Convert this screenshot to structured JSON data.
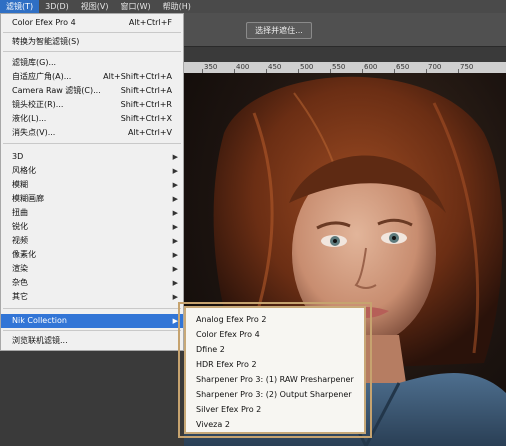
{
  "menubar": {
    "items": [
      "滤镜(T)",
      "3D(D)",
      "视图(V)",
      "窗口(W)",
      "帮助(H)"
    ]
  },
  "optbar": {
    "button_label": "选择并遮住..."
  },
  "ruler": {
    "ticks": [
      "350",
      "400",
      "450",
      "500",
      "550",
      "600",
      "650",
      "700",
      "750"
    ]
  },
  "filter_menu": {
    "items": [
      {
        "label": "Color Efex Pro 4",
        "shortcut": "Alt+Ctrl+F"
      },
      {
        "label": "转换为智能滤镜(S)",
        "shortcut": ""
      },
      {
        "label": "滤镜库(G)...",
        "shortcut": ""
      },
      {
        "label": "自适应广角(A)...",
        "shortcut": "Alt+Shift+Ctrl+A"
      },
      {
        "label": "Camera Raw 滤镜(C)...",
        "shortcut": "Shift+Ctrl+A"
      },
      {
        "label": "镜头校正(R)...",
        "shortcut": "Shift+Ctrl+R"
      },
      {
        "label": "液化(L)...",
        "shortcut": "Shift+Ctrl+X"
      },
      {
        "label": "消失点(V)...",
        "shortcut": "Alt+Ctrl+V"
      },
      {
        "label": "3D",
        "shortcut": ""
      },
      {
        "label": "风格化",
        "shortcut": ""
      },
      {
        "label": "模糊",
        "shortcut": ""
      },
      {
        "label": "模糊画廊",
        "shortcut": ""
      },
      {
        "label": "扭曲",
        "shortcut": ""
      },
      {
        "label": "锐化",
        "shortcut": ""
      },
      {
        "label": "视频",
        "shortcut": ""
      },
      {
        "label": "像素化",
        "shortcut": ""
      },
      {
        "label": "渲染",
        "shortcut": ""
      },
      {
        "label": "杂色",
        "shortcut": ""
      },
      {
        "label": "其它",
        "shortcut": ""
      },
      {
        "label": "Nik Collection",
        "shortcut": ""
      },
      {
        "label": "浏览联机滤镜...",
        "shortcut": ""
      }
    ]
  },
  "nik_submenu": {
    "items": [
      "Analog Efex Pro 2",
      "Color Efex Pro 4",
      "Dfine 2",
      "HDR Efex Pro 2",
      "Sharpener Pro 3: (1) RAW Presharpener",
      "Sharpener Pro 3: (2) Output Sharpener",
      "Silver Efex Pro 2",
      "Viveza 2"
    ]
  }
}
